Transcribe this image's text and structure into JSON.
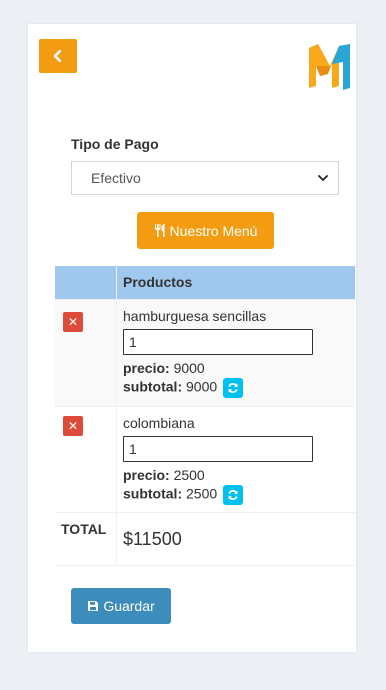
{
  "header": {
    "back_icon": "chevron-left-icon",
    "logo": "brand-logo"
  },
  "payment": {
    "label": "Tipo de Pago",
    "selected": "Efectivo"
  },
  "menu_button": {
    "label": "Nuestro Menú",
    "icon": "utensils-icon"
  },
  "table": {
    "header_label": "Productos",
    "items": [
      {
        "name": "hamburguesa sencillas",
        "qty": "1",
        "price_label": "precio:",
        "price": "9000",
        "subtotal_label": "subtotal:",
        "subtotal": "9000"
      },
      {
        "name": "colombiana",
        "qty": "1",
        "price_label": "precio:",
        "price": "2500",
        "subtotal_label": "subtotal:",
        "subtotal": "2500"
      }
    ],
    "total_label": "TOTAL",
    "total_value": "$11500"
  },
  "save_button": {
    "label": "Guardar",
    "icon": "floppy-disk-icon"
  },
  "colors": {
    "orange": "#f39c12",
    "blue": "#3c8dbc",
    "red": "#dd4b39",
    "cyan": "#00c0ef",
    "table_header": "#a0c8ef"
  }
}
